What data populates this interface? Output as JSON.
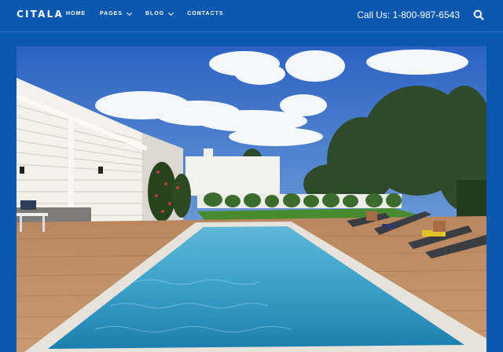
{
  "header": {
    "logo": "CITALA",
    "nav": [
      {
        "label": "HOME"
      },
      {
        "label": "PAGES"
      },
      {
        "label": "BLOG"
      },
      {
        "label": "CONTACTS"
      }
    ],
    "phone": "Call Us: 1-800-987-6543"
  },
  "hero": {
    "image": "pool-villa-photo"
  },
  "colors": {
    "header_bg": "#0a57b0",
    "text": "#ffffff"
  }
}
